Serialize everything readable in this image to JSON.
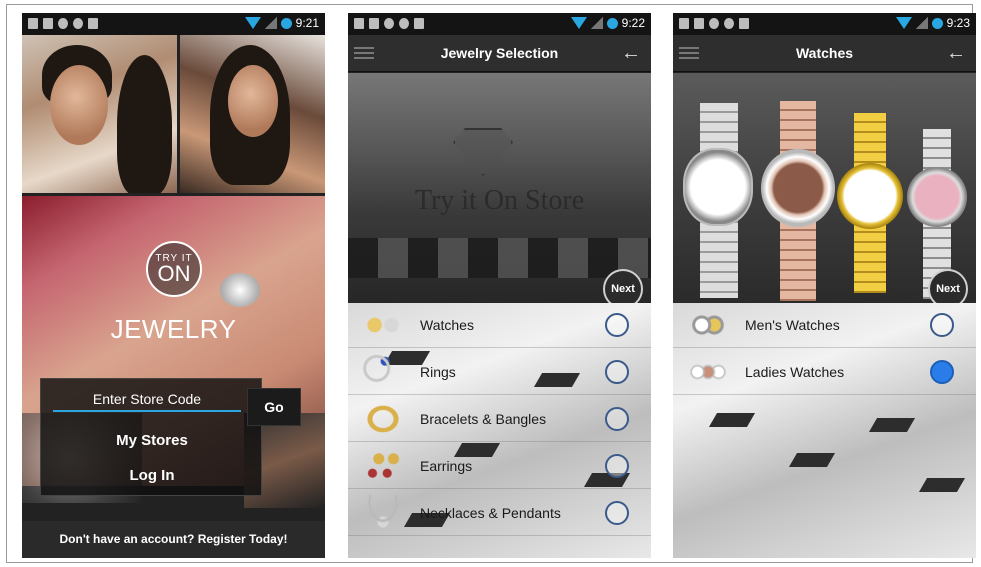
{
  "status_bar": [
    {
      "time": "9:21"
    },
    {
      "time": "9:22"
    },
    {
      "time": "9:23"
    }
  ],
  "login_screen": {
    "logo_top": "TRY IT",
    "logo_bottom": "ON",
    "brand_word": "JEWELRY",
    "store_code_placeholder": "Enter Store Code",
    "go_label": "Go",
    "my_stores_label": "My Stores",
    "log_in_label": "Log In",
    "register_text": "Don't have an account? Register Today!"
  },
  "selection_screen": {
    "title": "Jewelry Selection",
    "store_name": "Try it On Store",
    "next_label": "Next",
    "items": [
      {
        "label": "Watches",
        "selected": false
      },
      {
        "label": "Rings",
        "selected": false
      },
      {
        "label": "Bracelets & Bangles",
        "selected": false
      },
      {
        "label": "Earrings",
        "selected": false
      },
      {
        "label": "Necklaces & Pendants",
        "selected": false
      }
    ]
  },
  "watches_screen": {
    "title": "Watches",
    "next_label": "Next",
    "items": [
      {
        "label": "Men's Watches",
        "selected": false
      },
      {
        "label": "Ladies Watches",
        "selected": true
      }
    ]
  },
  "colors": {
    "accent": "#2aa7e0",
    "radio_selected": "#2a7de8",
    "appbar": "#2e2e2e"
  }
}
